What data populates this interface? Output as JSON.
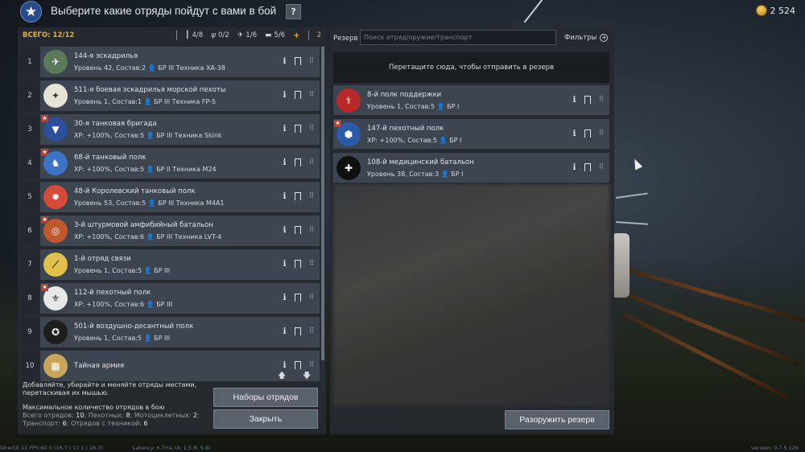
{
  "header": {
    "title": "Выберите какие отряды пойдут с вами в бой",
    "help_label": "?",
    "currency": "2 524"
  },
  "toolbar": {
    "total": "ВСЕГО: 12/12",
    "counts": [
      {
        "icon": "soldier-icon",
        "value": "4/8"
      },
      {
        "icon": "motorcycle-icon",
        "value": "0/2"
      },
      {
        "icon": "plane-icon",
        "value": "1/6"
      },
      {
        "icon": "tank-icon",
        "value": "5/6"
      }
    ],
    "plus": "+",
    "extra": "2"
  },
  "squads": [
    {
      "num": "1",
      "name": "144-я эскадрилья",
      "sub": "Уровень 42, Состав:2 👤 БР III  Техника XA-38",
      "emblem_color": "#5a7a5a",
      "emblem_text": "✈",
      "new": false
    },
    {
      "num": "2",
      "name": "511-я боевая эскадрилья морской пехоты",
      "sub": "Уровень 1, Состав:1 👤 БР III  Техника FP-5",
      "emblem_color": "#e8e2d5",
      "emblem_text": "✦",
      "new": false
    },
    {
      "num": "3",
      "name": "30-я танковая бригада",
      "sub": "XP: +100%, Состав:5 👤 БР III  Техника Skink",
      "emblem_color": "#2c4f9a",
      "emblem_text": "▼",
      "new": true
    },
    {
      "num": "4",
      "name": "68-й танковый полк",
      "sub": "XP: +100%, Состав:5 👤 БР II  Техника M24",
      "emblem_color": "#3b74c7",
      "emblem_text": "♞",
      "new": true
    },
    {
      "num": "5",
      "name": "48-й Королевский танковый полк",
      "sub": "Уровень 53, Состав:5 👤 БР III  Техника M4A1",
      "emblem_color": "#d64a3a",
      "emblem_text": "✹",
      "new": false
    },
    {
      "num": "6",
      "name": "3-й штурмовой амфибийный батальон",
      "sub": "XP: +100%, Состав:6 👤 БР III  Техника LVT-4",
      "emblem_color": "#c0582e",
      "emblem_text": "◎",
      "new": true
    },
    {
      "num": "7",
      "name": "1-й отряд связи",
      "sub": "Уровень 1, Состав:5 👤 БР III",
      "emblem_color": "#e0c24a",
      "emblem_text": "⟋",
      "new": false
    },
    {
      "num": "8",
      "name": "112-й пехотный полк",
      "sub": "XP: +100%, Состав:6 👤 БР III",
      "emblem_color": "#e8e8e8",
      "emblem_text": "⚜",
      "new": true
    },
    {
      "num": "9",
      "name": "501-й воздушно-десантный полк",
      "sub": "Уровень 1, Состав:5 👤 БР III",
      "emblem_color": "#1d1d1d",
      "emblem_text": "✪",
      "new": false
    },
    {
      "num": "10",
      "name": "Тайная армия",
      "sub": "",
      "emblem_color": "#c7a55a",
      "emblem_text": "▦",
      "new": false
    }
  ],
  "hint": {
    "line1": "Добавляйте, убирайте и меняйте отряды местами, перетаскивая их мышью.",
    "max_title": "Максимальное количество отрядов в бою",
    "stats_1_label": "Всего отрядов:",
    "stats_1_value": "10",
    "stats_2_label": "Пехотных:",
    "stats_2_value": "8",
    "stats_3_label": "Мотоциклетных:",
    "stats_3_value": "2",
    "stats_4_label": "Транспорт:",
    "stats_4_value": "6",
    "stats_5_label": "Отрядов с техникой:",
    "stats_5_value": "6"
  },
  "buttons": {
    "presets": "Наборы отрядов",
    "close": "Закрыть",
    "disarm": "Разоружить резерв"
  },
  "reserve": {
    "label": "Резерв",
    "search_placeholder": "Поиск отряд/оружие/транспорт",
    "filters": "Фильтры",
    "drop_zone": "Перетащите сюда, чтобы отправить в резерв",
    "items": [
      {
        "name": "8-й полк поддержки",
        "sub": "Уровень 1, Состав:5 👤 БР I",
        "emblem_color": "#b82a2a",
        "emblem_text": "⚕",
        "new": false
      },
      {
        "name": "147-й пехотный полк",
        "sub": "XP: +100%, Состав:5 👤 БР I",
        "emblem_color": "#2a5aa8",
        "emblem_text": "⬢",
        "new": true
      },
      {
        "name": "108-й медицинский батальон",
        "sub": "Уровень 38, Состав:3 👤 БР I",
        "emblem_color": "#101010",
        "emblem_text": "✚",
        "new": false
      }
    ]
  },
  "footer": {
    "left": "DirectX 11  FPS:60.0 (16.7 | 17.1 | 16.7)",
    "middle": "Latency: 6.7ms (A: 1.5 R: 5.6)",
    "right": "version: 0.7.5.129"
  }
}
